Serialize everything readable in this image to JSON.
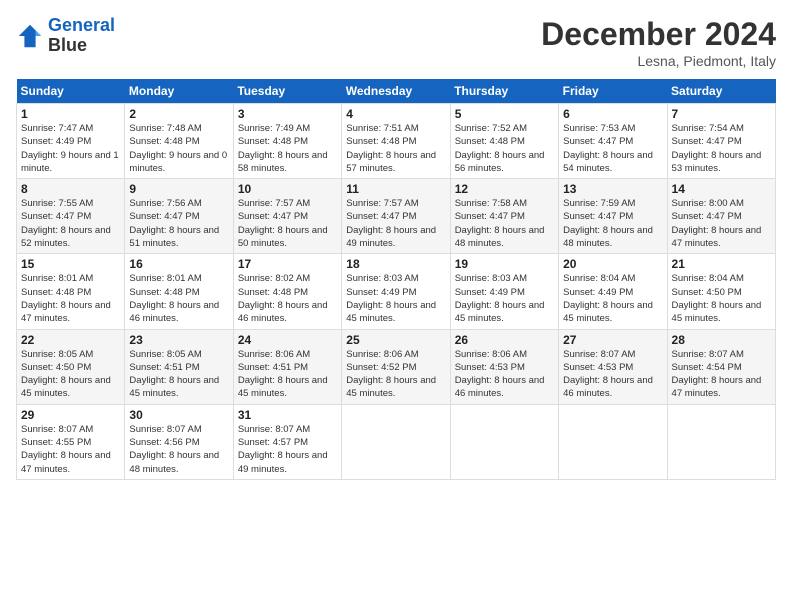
{
  "logo": {
    "line1": "General",
    "line2": "Blue"
  },
  "title": "December 2024",
  "location": "Lesna, Piedmont, Italy",
  "days_of_week": [
    "Sunday",
    "Monday",
    "Tuesday",
    "Wednesday",
    "Thursday",
    "Friday",
    "Saturday"
  ],
  "weeks": [
    [
      {
        "day": "1",
        "sunrise": "7:47 AM",
        "sunset": "4:49 PM",
        "daylight": "9 hours and 1 minute."
      },
      {
        "day": "2",
        "sunrise": "7:48 AM",
        "sunset": "4:48 PM",
        "daylight": "9 hours and 0 minutes."
      },
      {
        "day": "3",
        "sunrise": "7:49 AM",
        "sunset": "4:48 PM",
        "daylight": "8 hours and 58 minutes."
      },
      {
        "day": "4",
        "sunrise": "7:51 AM",
        "sunset": "4:48 PM",
        "daylight": "8 hours and 57 minutes."
      },
      {
        "day": "5",
        "sunrise": "7:52 AM",
        "sunset": "4:48 PM",
        "daylight": "8 hours and 56 minutes."
      },
      {
        "day": "6",
        "sunrise": "7:53 AM",
        "sunset": "4:47 PM",
        "daylight": "8 hours and 54 minutes."
      },
      {
        "day": "7",
        "sunrise": "7:54 AM",
        "sunset": "4:47 PM",
        "daylight": "8 hours and 53 minutes."
      }
    ],
    [
      {
        "day": "8",
        "sunrise": "7:55 AM",
        "sunset": "4:47 PM",
        "daylight": "8 hours and 52 minutes."
      },
      {
        "day": "9",
        "sunrise": "7:56 AM",
        "sunset": "4:47 PM",
        "daylight": "8 hours and 51 minutes."
      },
      {
        "day": "10",
        "sunrise": "7:57 AM",
        "sunset": "4:47 PM",
        "daylight": "8 hours and 50 minutes."
      },
      {
        "day": "11",
        "sunrise": "7:57 AM",
        "sunset": "4:47 PM",
        "daylight": "8 hours and 49 minutes."
      },
      {
        "day": "12",
        "sunrise": "7:58 AM",
        "sunset": "4:47 PM",
        "daylight": "8 hours and 48 minutes."
      },
      {
        "day": "13",
        "sunrise": "7:59 AM",
        "sunset": "4:47 PM",
        "daylight": "8 hours and 48 minutes."
      },
      {
        "day": "14",
        "sunrise": "8:00 AM",
        "sunset": "4:47 PM",
        "daylight": "8 hours and 47 minutes."
      }
    ],
    [
      {
        "day": "15",
        "sunrise": "8:01 AM",
        "sunset": "4:48 PM",
        "daylight": "8 hours and 47 minutes."
      },
      {
        "day": "16",
        "sunrise": "8:01 AM",
        "sunset": "4:48 PM",
        "daylight": "8 hours and 46 minutes."
      },
      {
        "day": "17",
        "sunrise": "8:02 AM",
        "sunset": "4:48 PM",
        "daylight": "8 hours and 46 minutes."
      },
      {
        "day": "18",
        "sunrise": "8:03 AM",
        "sunset": "4:49 PM",
        "daylight": "8 hours and 45 minutes."
      },
      {
        "day": "19",
        "sunrise": "8:03 AM",
        "sunset": "4:49 PM",
        "daylight": "8 hours and 45 minutes."
      },
      {
        "day": "20",
        "sunrise": "8:04 AM",
        "sunset": "4:49 PM",
        "daylight": "8 hours and 45 minutes."
      },
      {
        "day": "21",
        "sunrise": "8:04 AM",
        "sunset": "4:50 PM",
        "daylight": "8 hours and 45 minutes."
      }
    ],
    [
      {
        "day": "22",
        "sunrise": "8:05 AM",
        "sunset": "4:50 PM",
        "daylight": "8 hours and 45 minutes."
      },
      {
        "day": "23",
        "sunrise": "8:05 AM",
        "sunset": "4:51 PM",
        "daylight": "8 hours and 45 minutes."
      },
      {
        "day": "24",
        "sunrise": "8:06 AM",
        "sunset": "4:51 PM",
        "daylight": "8 hours and 45 minutes."
      },
      {
        "day": "25",
        "sunrise": "8:06 AM",
        "sunset": "4:52 PM",
        "daylight": "8 hours and 45 minutes."
      },
      {
        "day": "26",
        "sunrise": "8:06 AM",
        "sunset": "4:53 PM",
        "daylight": "8 hours and 46 minutes."
      },
      {
        "day": "27",
        "sunrise": "8:07 AM",
        "sunset": "4:53 PM",
        "daylight": "8 hours and 46 minutes."
      },
      {
        "day": "28",
        "sunrise": "8:07 AM",
        "sunset": "4:54 PM",
        "daylight": "8 hours and 47 minutes."
      }
    ],
    [
      {
        "day": "29",
        "sunrise": "8:07 AM",
        "sunset": "4:55 PM",
        "daylight": "8 hours and 47 minutes."
      },
      {
        "day": "30",
        "sunrise": "8:07 AM",
        "sunset": "4:56 PM",
        "daylight": "8 hours and 48 minutes."
      },
      {
        "day": "31",
        "sunrise": "8:07 AM",
        "sunset": "4:57 PM",
        "daylight": "8 hours and 49 minutes."
      },
      null,
      null,
      null,
      null
    ]
  ]
}
